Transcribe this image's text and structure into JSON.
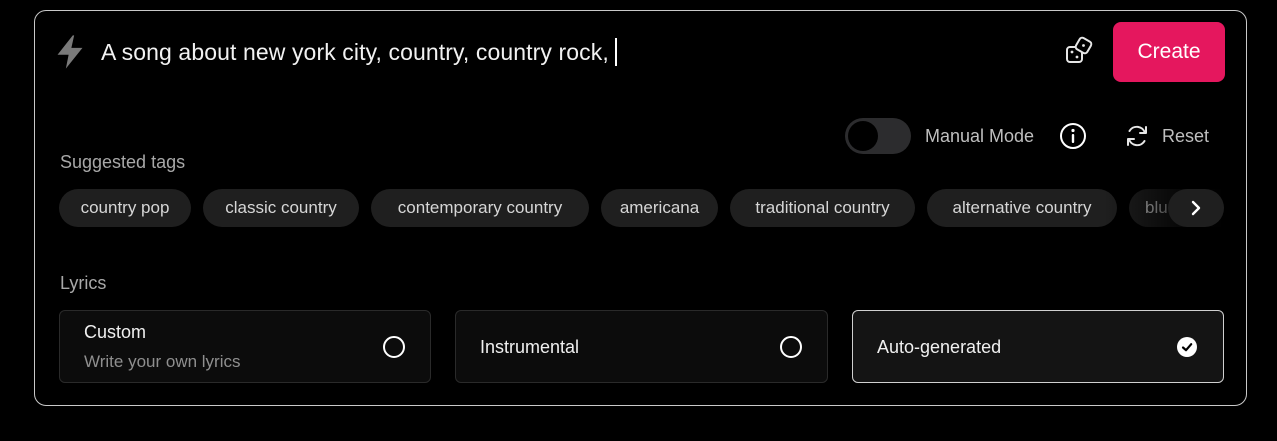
{
  "prompt": {
    "text": "A song about new york city, country, country rock,"
  },
  "header": {
    "create_label": "Create"
  },
  "controls": {
    "manual_mode_label": "Manual Mode",
    "manual_mode_on": false,
    "reset_label": "Reset"
  },
  "suggested_tags": {
    "label": "Suggested tags",
    "tags": [
      "country pop",
      "classic country",
      "contemporary country",
      "americana",
      "traditional country",
      "alternative country",
      "bluegrass"
    ]
  },
  "lyrics": {
    "label": "Lyrics",
    "options": [
      {
        "title": "Custom",
        "subtitle": "Write your own lyrics",
        "selected": false
      },
      {
        "title": "Instrumental",
        "selected": false
      },
      {
        "title": "Auto-generated",
        "selected": true
      }
    ]
  },
  "icons": {
    "prompt": "lightning-bolt-icon",
    "random": "dice-icon",
    "info": "info-icon",
    "reset": "refresh-icon",
    "next": "chevron-right-icon"
  },
  "colors": {
    "accent": "#e5175e",
    "background": "#000000",
    "tag_bg": "#1f1f1f"
  }
}
